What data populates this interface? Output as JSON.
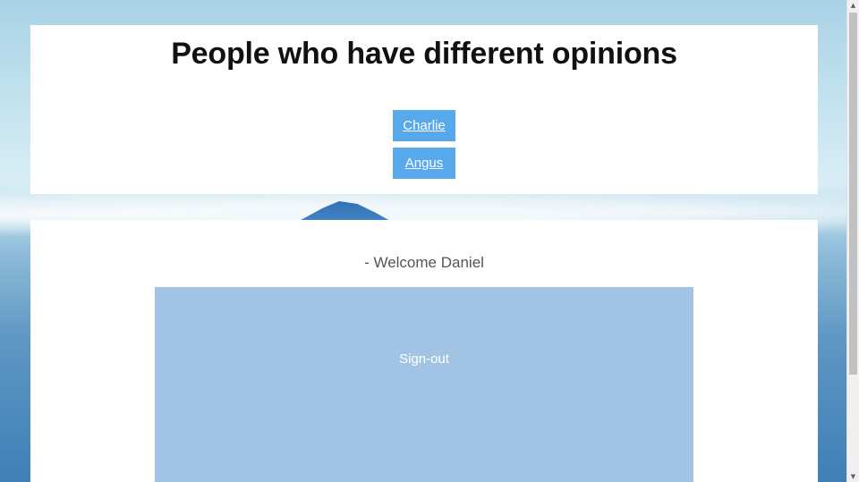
{
  "header": {
    "title": "People who have different opinions",
    "people": [
      {
        "name": "Charlie"
      },
      {
        "name": "Angus"
      }
    ]
  },
  "main": {
    "welcome": "- Welcome Daniel",
    "signout_label": "Sign-out"
  },
  "scrollbar": {
    "up_icon": "▲",
    "down_icon": "▼"
  },
  "colors": {
    "button_bg": "#58a9ec",
    "signout_bg": "#a2c4e4"
  }
}
